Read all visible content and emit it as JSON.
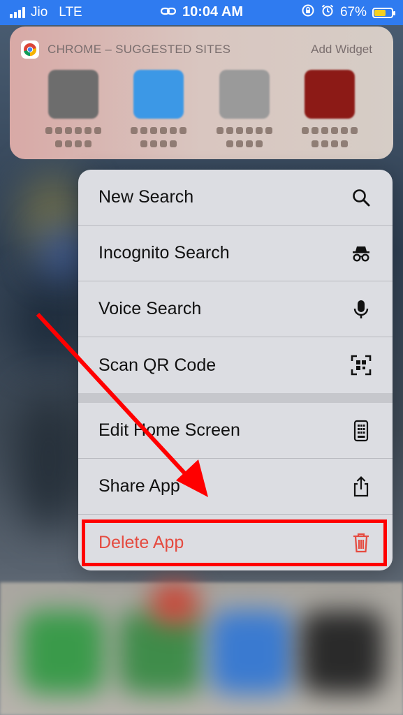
{
  "status_bar": {
    "carrier": "Jio",
    "network": "LTE",
    "time": "10:04 AM",
    "battery": "67%",
    "battery_level": 0.67
  },
  "widget": {
    "title": "CHROME – SUGGESTED SITES",
    "action": "Add Widget",
    "tile_colors": [
      "#6d6d6d",
      "#3c98e6",
      "#9a9a9a",
      "#8c1a16"
    ]
  },
  "menu": {
    "items": [
      {
        "label": "New Search",
        "icon": "search-icon"
      },
      {
        "label": "Incognito Search",
        "icon": "incognito-icon"
      },
      {
        "label": "Voice Search",
        "icon": "microphone-icon"
      },
      {
        "label": "Scan QR Code",
        "icon": "qr-scan-icon"
      },
      {
        "label": "Edit Home Screen",
        "icon": "phone-apps-icon"
      },
      {
        "label": "Share App",
        "icon": "share-icon"
      },
      {
        "label": "Delete App",
        "icon": "trash-icon"
      }
    ]
  },
  "colors": {
    "status_bar": "#2f7bf0",
    "danger": "#e54b40",
    "annotation": "#ff0000"
  }
}
